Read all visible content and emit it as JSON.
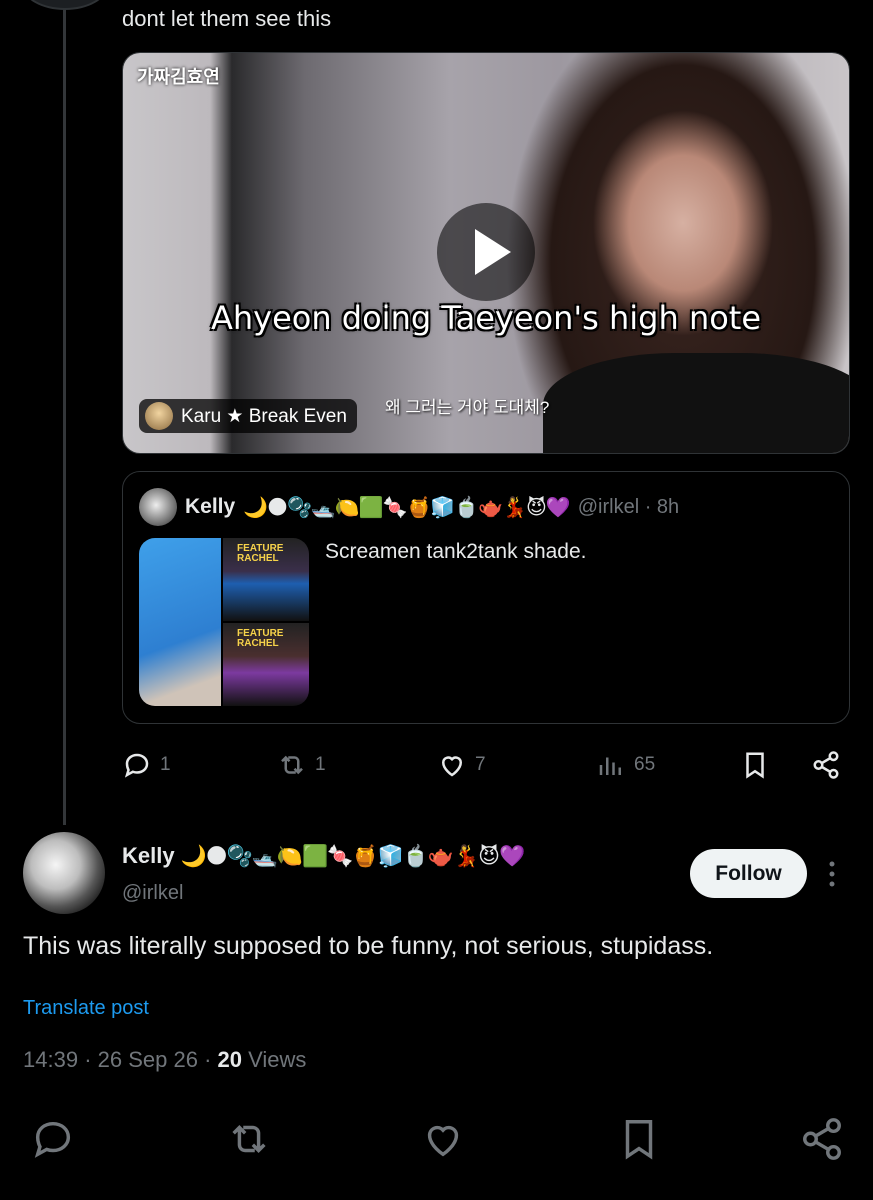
{
  "parent_post": {
    "text": "dont let them see this",
    "video": {
      "watermark": "가짜김효연",
      "caption": "Ahyeon doing Taeyeon's high note",
      "subtitle": "왜 그러는 거야 도대체?",
      "attribution": "Karu ★ Break Even"
    },
    "quoted": {
      "name": "Kelly",
      "emoji": "🌙🌑🫧🛥️🍋🟩🍬🍯🧊🍵🫖💃😈💜",
      "handle": "@irlkel · 8h",
      "text": "Screamen tank2tank shade.",
      "media_label": "FEATURE RACHEL"
    },
    "actions": {
      "replies": "1",
      "reposts": "1",
      "likes": "7",
      "views": "65"
    }
  },
  "main_post": {
    "name": "Kelly",
    "emoji": "🌙🌑🫧🛥️🍋🟩🍬🍯🧊🍵🫖💃😈💜",
    "handle": "@irlkel",
    "follow_label": "Follow",
    "text": "This was literally supposed to be funny, not serious, stupidass.",
    "translate_label": "Translate post",
    "time": "14:39",
    "date": "26 Sep 26",
    "views_count": "20",
    "views_label": "Views"
  },
  "colors": {
    "background": "#000000",
    "text": "#e7e9ea",
    "muted": "#71767b",
    "link": "#1d9bf0",
    "border": "#2f3336"
  }
}
